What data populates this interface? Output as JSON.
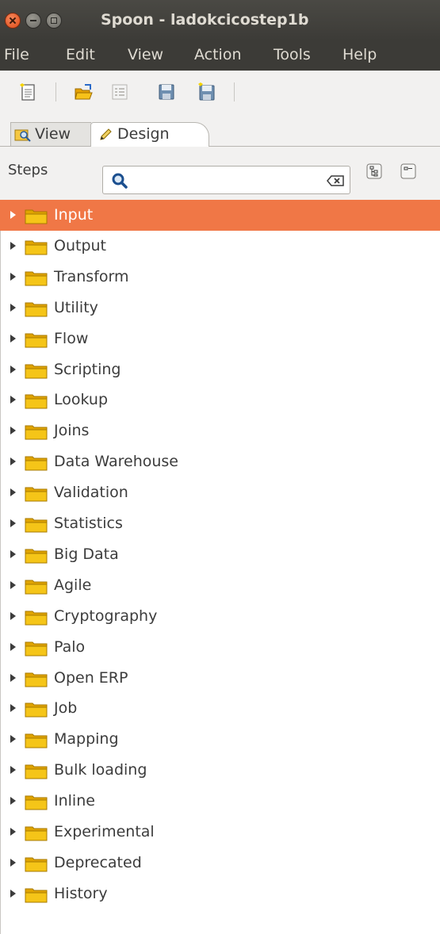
{
  "window": {
    "title": "Spoon - ladokcicostep1b"
  },
  "menu": [
    "File",
    "Edit",
    "View",
    "Action",
    "Tools",
    "Help"
  ],
  "perspective_tabs": {
    "view": "View",
    "design": "Design"
  },
  "steps": {
    "label": "Steps",
    "search_value": "",
    "search_placeholder": ""
  },
  "tree": {
    "selected_index": 0,
    "items": [
      "Input",
      "Output",
      "Transform",
      "Utility",
      "Flow",
      "Scripting",
      "Lookup",
      "Joins",
      "Data Warehouse",
      "Validation",
      "Statistics",
      "Big Data",
      "Agile",
      "Cryptography",
      "Palo",
      "Open ERP",
      "Job",
      "Mapping",
      "Bulk loading",
      "Inline",
      "Experimental",
      "Deprecated",
      "History"
    ]
  },
  "colors": {
    "selection": "#f07746",
    "titlebar": "#3c3b37",
    "folder": "#f5c518"
  }
}
